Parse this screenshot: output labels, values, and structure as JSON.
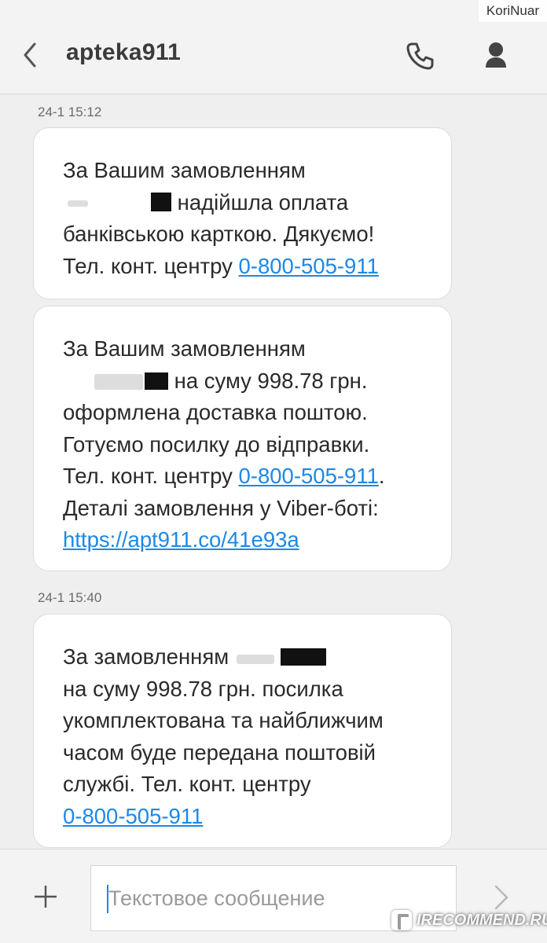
{
  "watermark_user": "KoriNuar",
  "header": {
    "title": "apteka911"
  },
  "icons": {
    "back": "chevron-left-icon",
    "call": "phone-icon",
    "contact": "person-icon",
    "add": "plus-icon",
    "send": "chevron-right-icon"
  },
  "messages": [
    {
      "timestamp": "24-1 15:12",
      "lines": [
        "За Вашим замовленням",
        "надійшла оплата",
        "банківською карткою. Дякуємо!",
        "Тел. конт. центру"
      ],
      "phone": "0-800-505-911"
    },
    {
      "lines": [
        "За Вашим замовленням",
        "на суму 998.78 грн.",
        "оформлена доставка поштою.",
        "Готуємо посилку до відправки.",
        "Тел. конт. центру",
        "Деталі замовлення у Viber-боті:"
      ],
      "phone": "0-800-505-911",
      "phone_suffix": ".",
      "url": "https://apt911.co/41e93a"
    },
    {
      "timestamp": "24-1 15:40",
      "lines": [
        "За замовленням",
        "на суму 998.78 грн. посилка",
        "укомплектована та найближчим",
        "часом буде передана поштовій",
        "службі. Тел. конт. центру"
      ],
      "phone": "0-800-505-911"
    }
  ],
  "compose": {
    "placeholder": "Текстовое сообщение"
  },
  "recommend_watermark": "IRECOMMEND.RU",
  "colors": {
    "link": "#1e88e5",
    "header_bg": "#f3f3f3",
    "bubble_bg": "#ffffff",
    "background": "#efefef"
  }
}
